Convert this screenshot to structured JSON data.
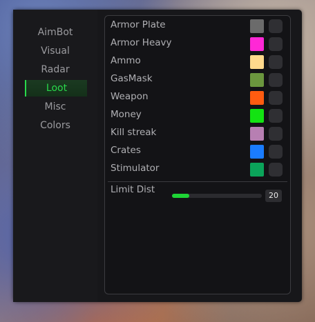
{
  "sidebar": {
    "items": [
      {
        "label": "AimBot",
        "active": false
      },
      {
        "label": "Visual",
        "active": false
      },
      {
        "label": "Radar",
        "active": false
      },
      {
        "label": "Loot",
        "active": true
      },
      {
        "label": "Misc",
        "active": false
      },
      {
        "label": "Colors",
        "active": false
      }
    ]
  },
  "loot": {
    "items": [
      {
        "label": "Armor Plate",
        "color": "#6b6b6b"
      },
      {
        "label": "Armor Heavy",
        "color": "#ff28d6"
      },
      {
        "label": "Ammo",
        "color": "#ffd98c"
      },
      {
        "label": "GasMask",
        "color": "#6b973e"
      },
      {
        "label": "Weapon",
        "color": "#ff5c10"
      },
      {
        "label": "Money",
        "color": "#13e312"
      },
      {
        "label": "Kill streak",
        "color": "#b77fb2"
      },
      {
        "label": "Crates",
        "color": "#1a7cff"
      },
      {
        "label": "Stimulator",
        "color": "#0ba45a"
      }
    ],
    "limit_dist": {
      "label": "Limit Dist",
      "value": "20",
      "fill_fraction": 0.19
    }
  },
  "colors": {
    "accent": "#29d94b",
    "slider_fill": "#1ed435"
  }
}
